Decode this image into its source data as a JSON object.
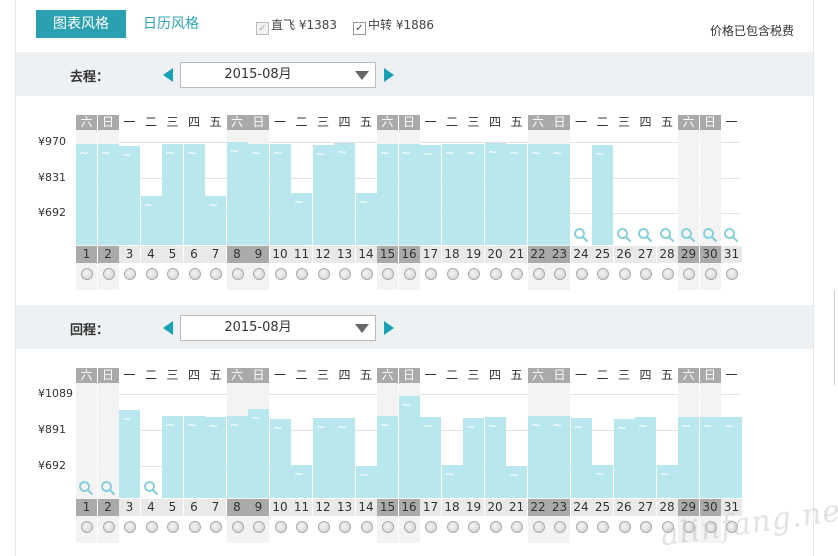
{
  "tabs": {
    "chart_style": "图表风格",
    "calendar_style": "日历风格"
  },
  "filters": {
    "direct": {
      "label": "直飞 ¥1383",
      "checked": true,
      "disabled": true
    },
    "transfer": {
      "label": "中转 ¥1886",
      "checked": true,
      "disabled": false
    }
  },
  "tax_note": "价格已包含税费",
  "outbound": {
    "label": "去程：",
    "month": "2015-08月",
    "y_labels": [
      "¥970",
      "¥831",
      "¥692"
    ],
    "days": [
      "1",
      "2",
      "3",
      "4",
      "5",
      "6",
      "7",
      "8",
      "9",
      "10",
      "11",
      "12",
      "13",
      "14",
      "15",
      "16",
      "17",
      "18",
      "19",
      "20",
      "21",
      "22",
      "23",
      "24",
      "25",
      "26",
      "27",
      "28",
      "29",
      "30",
      "31"
    ],
    "weekdays": [
      "六",
      "日",
      "一",
      "二",
      "三",
      "四",
      "五",
      "六",
      "日",
      "一",
      "二",
      "三",
      "四",
      "五",
      "六",
      "日",
      "一",
      "二",
      "三",
      "四",
      "五",
      "六",
      "日",
      "一",
      "二",
      "三",
      "四",
      "五",
      "六",
      "日",
      "一"
    ],
    "prices": [
      963,
      961,
      955,
      758,
      962,
      963,
      758,
      969,
      963,
      964,
      771,
      959,
      966,
      772,
      963,
      962,
      957,
      963,
      961,
      965,
      961,
      963,
      963,
      null,
      960,
      null,
      null,
      null,
      null,
      null,
      null
    ]
  },
  "return": {
    "label": "回程：",
    "month": "2015-08月",
    "y_labels": [
      "¥1089",
      "¥891",
      "¥692"
    ],
    "days": [
      "1",
      "2",
      "3",
      "4",
      "5",
      "6",
      "7",
      "8",
      "9",
      "10",
      "11",
      "12",
      "13",
      "14",
      "15",
      "16",
      "17",
      "18",
      "19",
      "20",
      "21",
      "22",
      "23",
      "24",
      "25",
      "26",
      "27",
      "28",
      "29",
      "30",
      "31"
    ],
    "weekdays": [
      "六",
      "日",
      "一",
      "二",
      "三",
      "四",
      "五",
      "六",
      "日",
      "一",
      "二",
      "三",
      "四",
      "五",
      "六",
      "日",
      "一",
      "二",
      "三",
      "四",
      "五",
      "六",
      "日",
      "一",
      "二",
      "三",
      "四",
      "五",
      "六",
      "日",
      "一"
    ],
    "prices": [
      null,
      null,
      1000,
      null,
      965,
      965,
      960,
      965,
      1005,
      950,
      700,
      955,
      955,
      692,
      965,
      1080,
      960,
      700,
      955,
      960,
      692,
      965,
      965,
      955,
      700,
      950,
      962,
      700,
      962,
      960,
      960
    ]
  },
  "watermark": "alinfang.net"
}
